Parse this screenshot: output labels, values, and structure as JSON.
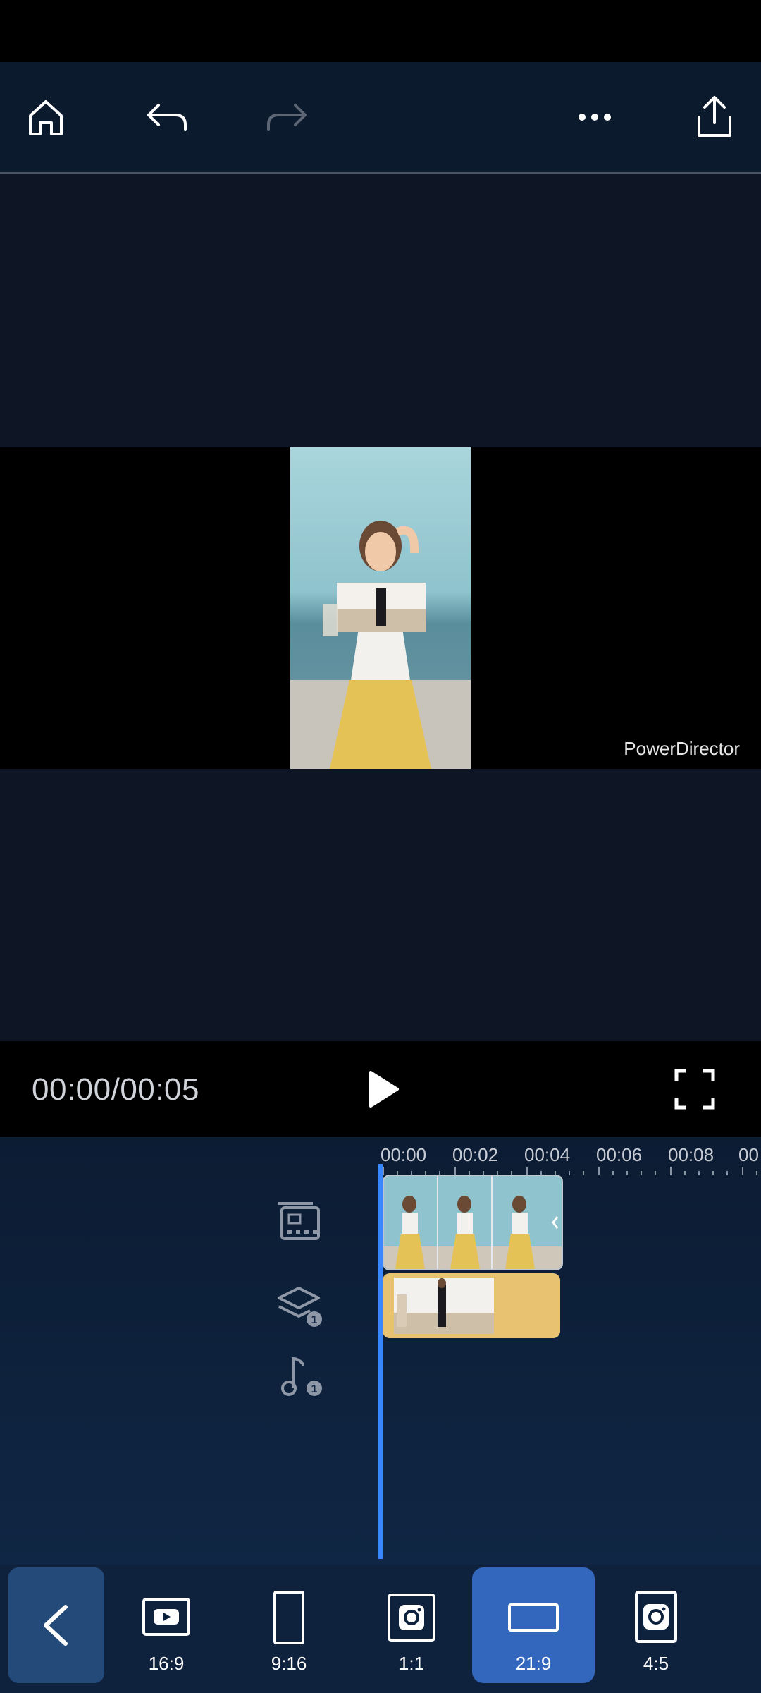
{
  "toolbar": {
    "icons": [
      "home-icon",
      "undo-icon",
      "redo-icon",
      "more-icon",
      "share-icon"
    ]
  },
  "preview": {
    "watermark": "PowerDirector"
  },
  "player": {
    "timecode": "00:00/00:05"
  },
  "timeline": {
    "ruler": [
      "00:00",
      "00:02",
      "00:04",
      "00:06",
      "00:08",
      "00"
    ],
    "pip_badge": "1",
    "music_badge": "1"
  },
  "aspect_ratios": [
    {
      "label": "16:9",
      "icon": "youtube-icon"
    },
    {
      "label": "9:16",
      "icon": "portrait-frame-icon"
    },
    {
      "label": "1:1",
      "icon": "instagram-icon"
    },
    {
      "label": "21:9",
      "icon": "widescreen-frame-icon",
      "selected": true
    },
    {
      "label": "4:5",
      "icon": "instagram-icon"
    }
  ],
  "colors": {
    "accent": "#3367be",
    "playhead": "#3a86ff",
    "pip_clip": "#e8c270",
    "toolbar_bg": "#0c1a2d"
  }
}
